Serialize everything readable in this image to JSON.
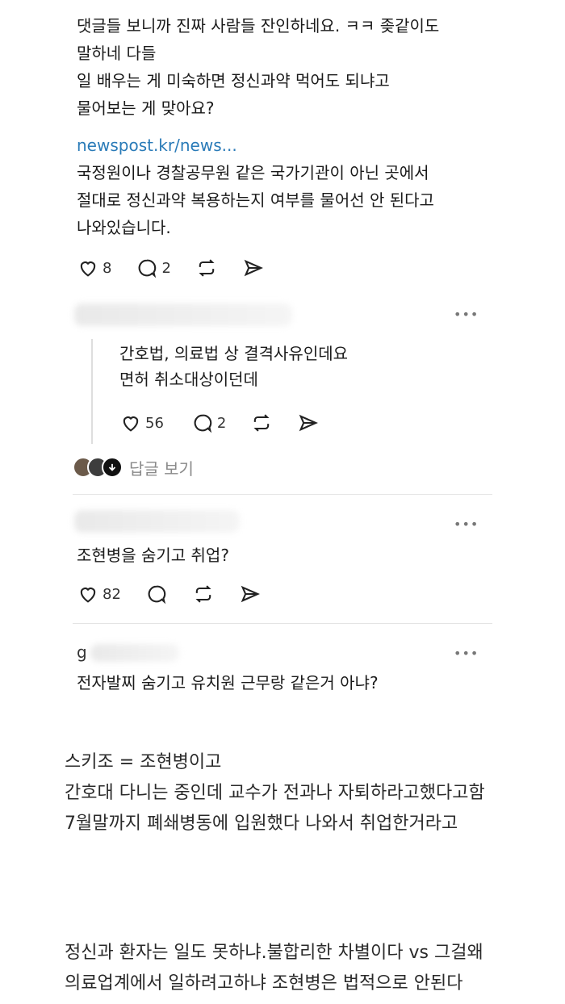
{
  "post1": {
    "lines": [
      "댓글들 보니까 진짜 사람들 잔인하네요. ㅋㅋ 좆같이도",
      "말하네 다들",
      "일 배우는 게 미숙하면 정신과약 먹어도 되냐고",
      "물어보는 게 맞아요?"
    ],
    "link": "newspost.kr/news...",
    "lines2": [
      "국정원이나 경찰공무원 같은 국가기관이 아닌 곳에서",
      "절대로 정신과약 복용하는지 여부를 물어선 안 된다고",
      "나와있습니다."
    ],
    "likes": "8",
    "comments": "2"
  },
  "reply1": {
    "more": "•••",
    "lines": [
      "간호법, 의료법 상 결격사유인데요",
      "면허 취소대상이던데"
    ],
    "likes": "56",
    "comments": "2",
    "view_replies": "답글 보기"
  },
  "post2": {
    "more": "•••",
    "text": "조현병을 숨기고 취업?",
    "likes": "82"
  },
  "post3": {
    "username_initial": "g",
    "more": "•••",
    "text": "전자발찌 숨기고 유치원 근무랑 같은거 아냐?"
  },
  "body_text": {
    "para1": [
      "스키조 = 조현병이고",
      "간호대 다니는 중인데 교수가 전과나 자퇴하라고했다고함",
      "7월말까지 폐쇄병동에 입원했다 나와서 취업한거라고"
    ],
    "para2": [
      "정신과 환자는 일도 못하냐.불합리한 차별이다 vs 그걸왜",
      "의료업계에서 일하려고하냐 조현병은 법적으로 안된다"
    ]
  },
  "colors": {
    "link": "#2a7bb8",
    "divider": "#e4e4e4",
    "text": "#1a1a1a"
  }
}
